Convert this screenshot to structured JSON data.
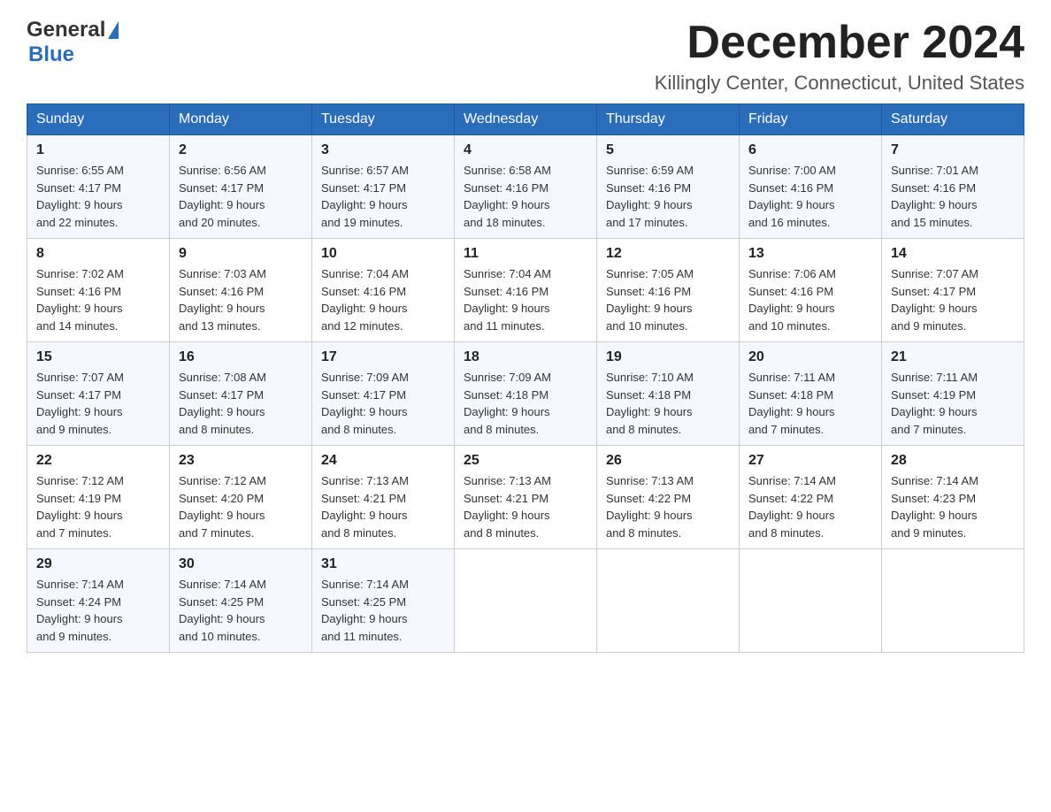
{
  "header": {
    "month_title": "December 2024",
    "location": "Killingly Center, Connecticut, United States",
    "logo_general": "General",
    "logo_blue": "Blue"
  },
  "weekdays": [
    "Sunday",
    "Monday",
    "Tuesday",
    "Wednesday",
    "Thursday",
    "Friday",
    "Saturday"
  ],
  "weeks": [
    [
      {
        "day": "1",
        "sunrise": "6:55 AM",
        "sunset": "4:17 PM",
        "daylight": "9 hours and 22 minutes."
      },
      {
        "day": "2",
        "sunrise": "6:56 AM",
        "sunset": "4:17 PM",
        "daylight": "9 hours and 20 minutes."
      },
      {
        "day": "3",
        "sunrise": "6:57 AM",
        "sunset": "4:17 PM",
        "daylight": "9 hours and 19 minutes."
      },
      {
        "day": "4",
        "sunrise": "6:58 AM",
        "sunset": "4:16 PM",
        "daylight": "9 hours and 18 minutes."
      },
      {
        "day": "5",
        "sunrise": "6:59 AM",
        "sunset": "4:16 PM",
        "daylight": "9 hours and 17 minutes."
      },
      {
        "day": "6",
        "sunrise": "7:00 AM",
        "sunset": "4:16 PM",
        "daylight": "9 hours and 16 minutes."
      },
      {
        "day": "7",
        "sunrise": "7:01 AM",
        "sunset": "4:16 PM",
        "daylight": "9 hours and 15 minutes."
      }
    ],
    [
      {
        "day": "8",
        "sunrise": "7:02 AM",
        "sunset": "4:16 PM",
        "daylight": "9 hours and 14 minutes."
      },
      {
        "day": "9",
        "sunrise": "7:03 AM",
        "sunset": "4:16 PM",
        "daylight": "9 hours and 13 minutes."
      },
      {
        "day": "10",
        "sunrise": "7:04 AM",
        "sunset": "4:16 PM",
        "daylight": "9 hours and 12 minutes."
      },
      {
        "day": "11",
        "sunrise": "7:04 AM",
        "sunset": "4:16 PM",
        "daylight": "9 hours and 11 minutes."
      },
      {
        "day": "12",
        "sunrise": "7:05 AM",
        "sunset": "4:16 PM",
        "daylight": "9 hours and 10 minutes."
      },
      {
        "day": "13",
        "sunrise": "7:06 AM",
        "sunset": "4:16 PM",
        "daylight": "9 hours and 10 minutes."
      },
      {
        "day": "14",
        "sunrise": "7:07 AM",
        "sunset": "4:17 PM",
        "daylight": "9 hours and 9 minutes."
      }
    ],
    [
      {
        "day": "15",
        "sunrise": "7:07 AM",
        "sunset": "4:17 PM",
        "daylight": "9 hours and 9 minutes."
      },
      {
        "day": "16",
        "sunrise": "7:08 AM",
        "sunset": "4:17 PM",
        "daylight": "9 hours and 8 minutes."
      },
      {
        "day": "17",
        "sunrise": "7:09 AM",
        "sunset": "4:17 PM",
        "daylight": "9 hours and 8 minutes."
      },
      {
        "day": "18",
        "sunrise": "7:09 AM",
        "sunset": "4:18 PM",
        "daylight": "9 hours and 8 minutes."
      },
      {
        "day": "19",
        "sunrise": "7:10 AM",
        "sunset": "4:18 PM",
        "daylight": "9 hours and 8 minutes."
      },
      {
        "day": "20",
        "sunrise": "7:11 AM",
        "sunset": "4:18 PM",
        "daylight": "9 hours and 7 minutes."
      },
      {
        "day": "21",
        "sunrise": "7:11 AM",
        "sunset": "4:19 PM",
        "daylight": "9 hours and 7 minutes."
      }
    ],
    [
      {
        "day": "22",
        "sunrise": "7:12 AM",
        "sunset": "4:19 PM",
        "daylight": "9 hours and 7 minutes."
      },
      {
        "day": "23",
        "sunrise": "7:12 AM",
        "sunset": "4:20 PM",
        "daylight": "9 hours and 7 minutes."
      },
      {
        "day": "24",
        "sunrise": "7:13 AM",
        "sunset": "4:21 PM",
        "daylight": "9 hours and 8 minutes."
      },
      {
        "day": "25",
        "sunrise": "7:13 AM",
        "sunset": "4:21 PM",
        "daylight": "9 hours and 8 minutes."
      },
      {
        "day": "26",
        "sunrise": "7:13 AM",
        "sunset": "4:22 PM",
        "daylight": "9 hours and 8 minutes."
      },
      {
        "day": "27",
        "sunrise": "7:14 AM",
        "sunset": "4:22 PM",
        "daylight": "9 hours and 8 minutes."
      },
      {
        "day": "28",
        "sunrise": "7:14 AM",
        "sunset": "4:23 PM",
        "daylight": "9 hours and 9 minutes."
      }
    ],
    [
      {
        "day": "29",
        "sunrise": "7:14 AM",
        "sunset": "4:24 PM",
        "daylight": "9 hours and 9 minutes."
      },
      {
        "day": "30",
        "sunrise": "7:14 AM",
        "sunset": "4:25 PM",
        "daylight": "9 hours and 10 minutes."
      },
      {
        "day": "31",
        "sunrise": "7:14 AM",
        "sunset": "4:25 PM",
        "daylight": "9 hours and 11 minutes."
      },
      null,
      null,
      null,
      null
    ]
  ],
  "labels": {
    "sunrise": "Sunrise:",
    "sunset": "Sunset:",
    "daylight": "Daylight:"
  }
}
